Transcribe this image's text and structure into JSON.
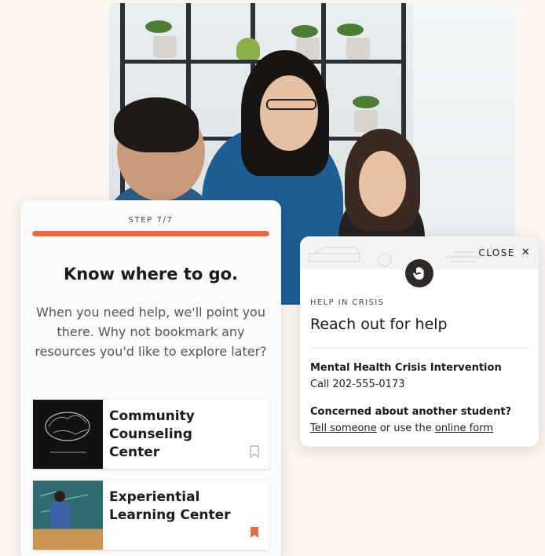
{
  "step_card": {
    "step_label": "STEP 7/7",
    "progress": 1.0,
    "title": "Know where to go.",
    "description": "When you need help, we'll point you there. Why not bookmark any resources you'd like to explore later?",
    "resources": [
      {
        "name": "Community Counseling Center",
        "bookmarked": false
      },
      {
        "name": "Experiential Learning Center",
        "bookmarked": true
      }
    ]
  },
  "crisis_popup": {
    "close_label": "CLOSE",
    "close_icon": "close-icon",
    "badge_icon": "hand-stop-icon",
    "kicker": "HELP IN CRISIS",
    "heading": "Reach out for help",
    "hotline_title": "Mental Health Crisis Intervention",
    "hotline_text": "Call 202-555-0173",
    "concern_title": "Concerned about another student?",
    "concern_link_1": "Tell someone",
    "concern_middle": " or use the ",
    "concern_link_2": "online form"
  },
  "colors": {
    "accent": "#ef6a3d",
    "background": "#fdf6ee"
  }
}
